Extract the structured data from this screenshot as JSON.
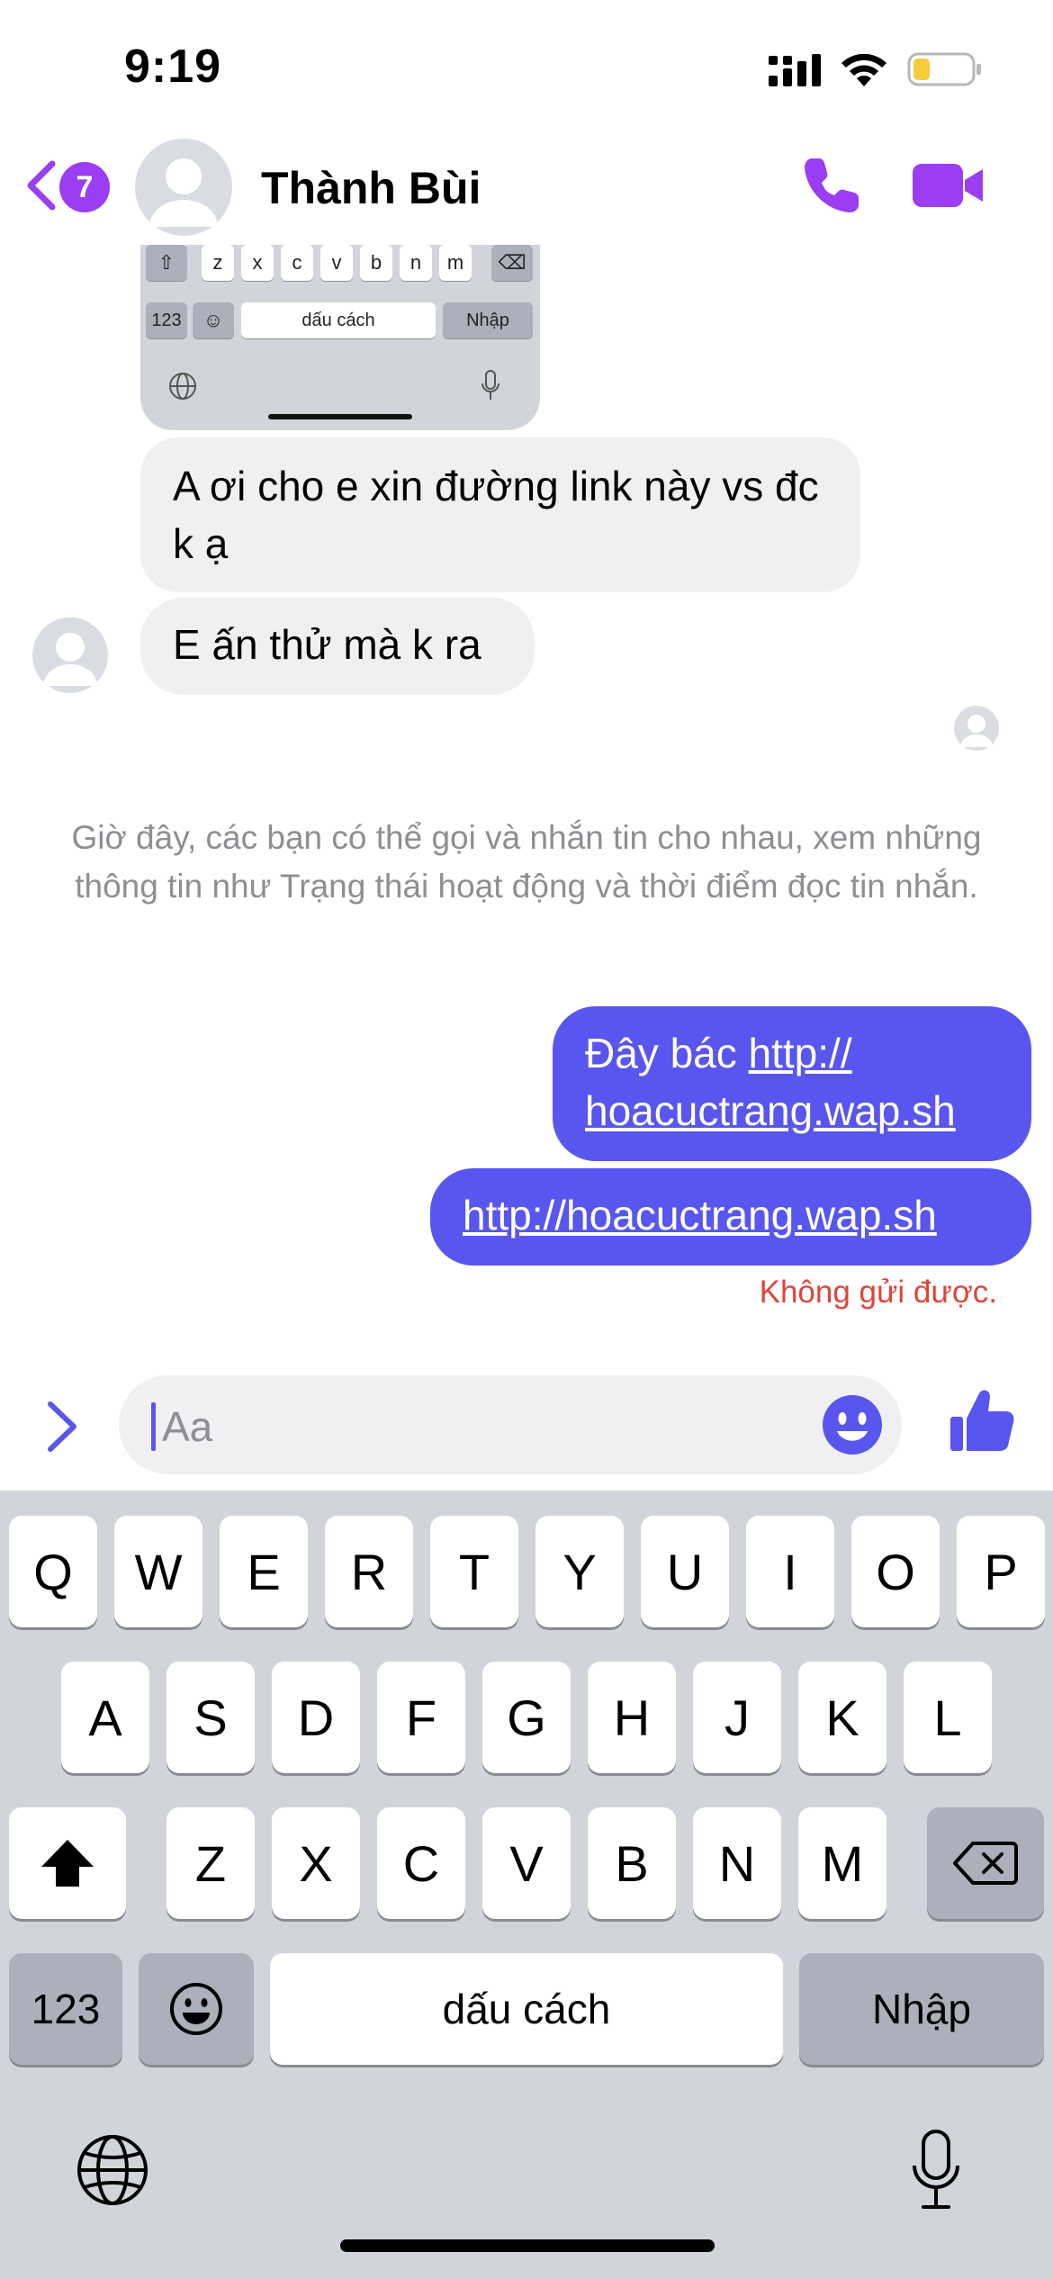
{
  "status_bar": {
    "time": "9:19"
  },
  "header": {
    "back_badge": "7",
    "contact_name": "Thành Bùi",
    "icons": [
      "chevron-left-icon",
      "phone-icon",
      "video-camera-icon"
    ],
    "accent_color": "#9b3df2"
  },
  "keyboard_thumbnail": {
    "row3_keys": [
      "z",
      "x",
      "c",
      "v",
      "b",
      "n",
      "m"
    ],
    "numbers_label": "123",
    "space_label": "dấu cách",
    "return_label": "Nhập"
  },
  "messages": {
    "incoming": [
      "A ơi cho e xin đường link này vs đc k ạ",
      "E ấn thử mà k ra"
    ],
    "info_notice": "Giờ đây, các bạn có thể gọi và nhắn tin cho nhau, xem những thông tin như Trạng thái hoạt động và thời điểm đọc tin nhắn.",
    "outgoing": [
      {
        "prefix": "Đây bác ",
        "link_line1": "http://",
        "link_line2": "hoacuctrang.wap.sh"
      },
      {
        "link": "http://hoacuctrang.wap.sh"
      }
    ],
    "error": "Không gửi được.",
    "outgoing_color": "#5856ee"
  },
  "composer": {
    "placeholder": "Aa"
  },
  "keyboard": {
    "row1": [
      "Q",
      "W",
      "E",
      "R",
      "T",
      "Y",
      "U",
      "I",
      "O",
      "P"
    ],
    "row2": [
      "A",
      "S",
      "D",
      "F",
      "G",
      "H",
      "J",
      "K",
      "L"
    ],
    "row3": [
      "Z",
      "X",
      "C",
      "V",
      "B",
      "N",
      "M"
    ],
    "numbers_label": "123",
    "space_label": "dấu cách",
    "return_label": "Nhập"
  }
}
